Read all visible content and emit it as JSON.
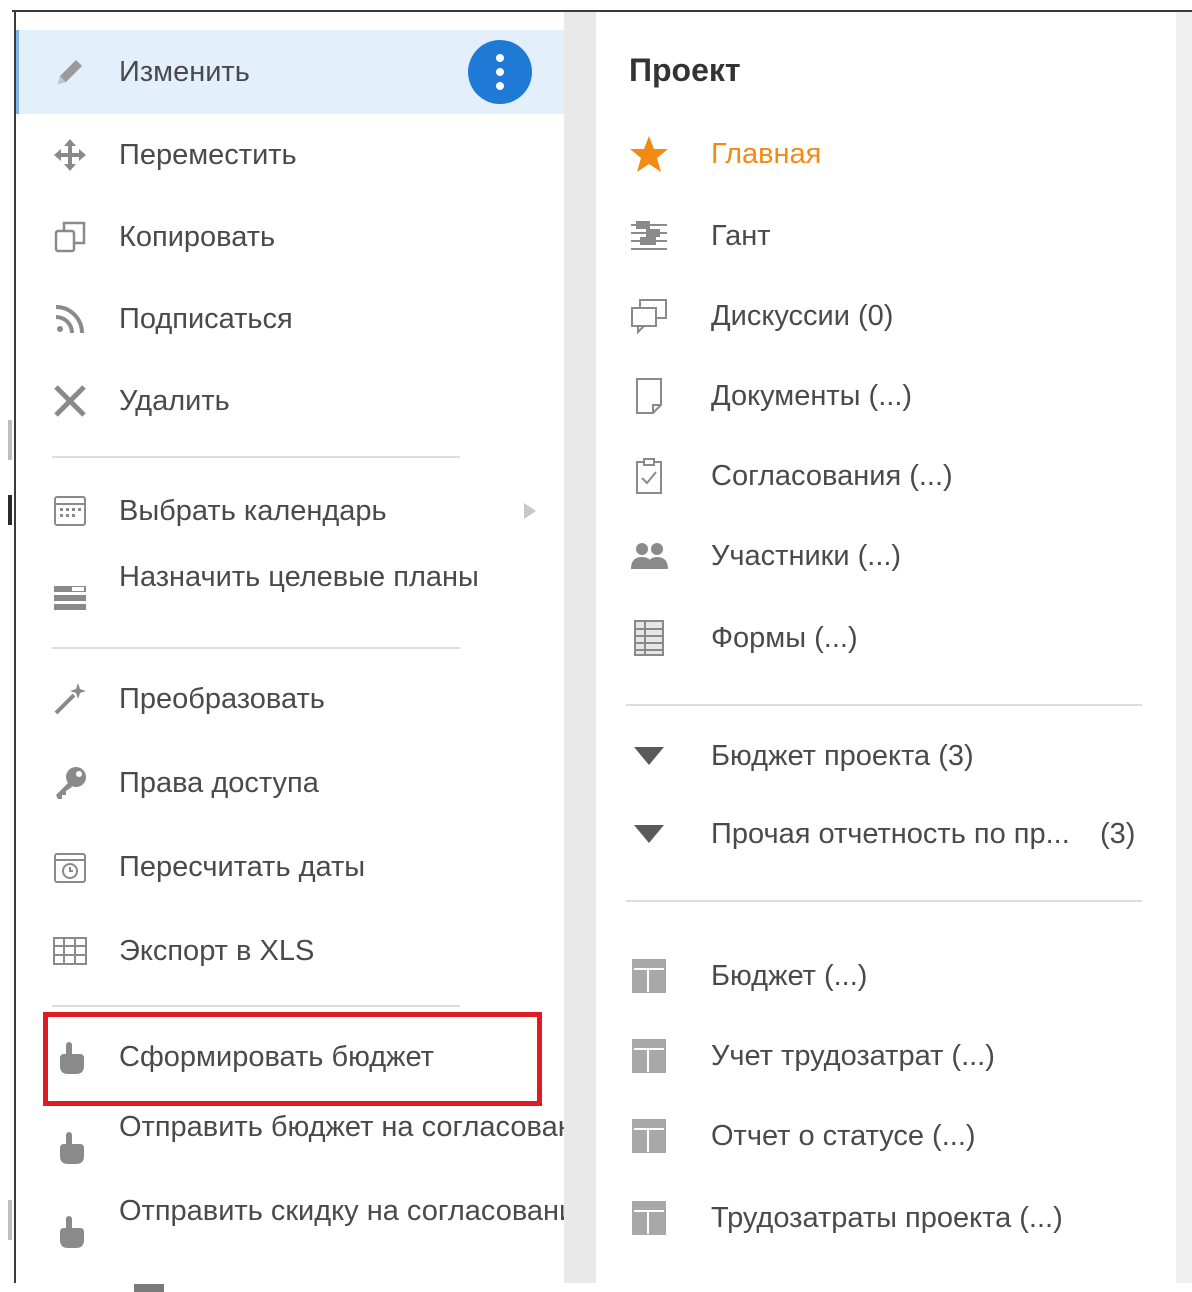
{
  "context_menu": {
    "items": [
      {
        "label": "Изменить",
        "icon": "pencil-icon"
      },
      {
        "label": "Переместить",
        "icon": "move-icon"
      },
      {
        "label": "Копировать",
        "icon": "copy-icon"
      },
      {
        "label": "Подписаться",
        "icon": "rss-icon"
      },
      {
        "label": "Удалить",
        "icon": "close-icon"
      },
      {
        "label": "Выбрать календарь",
        "icon": "calendar-icon"
      },
      {
        "label": "Назначить целевые планы",
        "icon": "baseline-icon"
      },
      {
        "label": "Преобразовать",
        "icon": "magic-wand-icon"
      },
      {
        "label": "Права доступа",
        "icon": "key-icon"
      },
      {
        "label": "Пересчитать даты",
        "icon": "recalc-dates-icon"
      },
      {
        "label": "Экспорт в XLS",
        "icon": "table-grid-icon"
      },
      {
        "label": "Сформировать бюджет",
        "icon": "hand-pointer-icon"
      },
      {
        "label": "Отправить бюджет на согласование",
        "icon": "hand-pointer-icon"
      },
      {
        "label": "Отправить скидку на согласование",
        "icon": "hand-pointer-icon"
      }
    ],
    "more_icon": "more-vertical-icon"
  },
  "project_panel": {
    "title": "Проект",
    "nav": [
      {
        "label": "Главная",
        "icon": "star-icon"
      },
      {
        "label": "Гант",
        "icon": "gantt-icon"
      },
      {
        "label": "Дискуссии (0)",
        "icon": "discussion-icon"
      },
      {
        "label": "Документы (...)",
        "icon": "document-icon"
      },
      {
        "label": "Согласования (...)",
        "icon": "approval-icon"
      },
      {
        "label": "Участники (...)",
        "icon": "people-icon"
      },
      {
        "label": "Формы (...)",
        "icon": "form-icon"
      }
    ],
    "groups": [
      {
        "label": "Бюджет проекта (3)",
        "icon": "expand-triangle-icon"
      },
      {
        "label": "Прочая отчетность по пр...",
        "count": "(3)",
        "icon": "expand-triangle-icon"
      }
    ],
    "reports": [
      {
        "label": "Бюджет (...)",
        "icon": "report-icon"
      },
      {
        "label": "Учет трудозатрат (...)",
        "icon": "report-icon"
      },
      {
        "label": "Отчет о статусе (...)",
        "icon": "report-icon"
      },
      {
        "label": "Трудозатраты проекта (...)",
        "icon": "report-icon"
      }
    ]
  },
  "colors": {
    "accent_blue": "#1f7ad6",
    "active_item_bg": "#e3f0fb",
    "highlight_red": "#e01b23",
    "home_orange": "#f28a13"
  }
}
